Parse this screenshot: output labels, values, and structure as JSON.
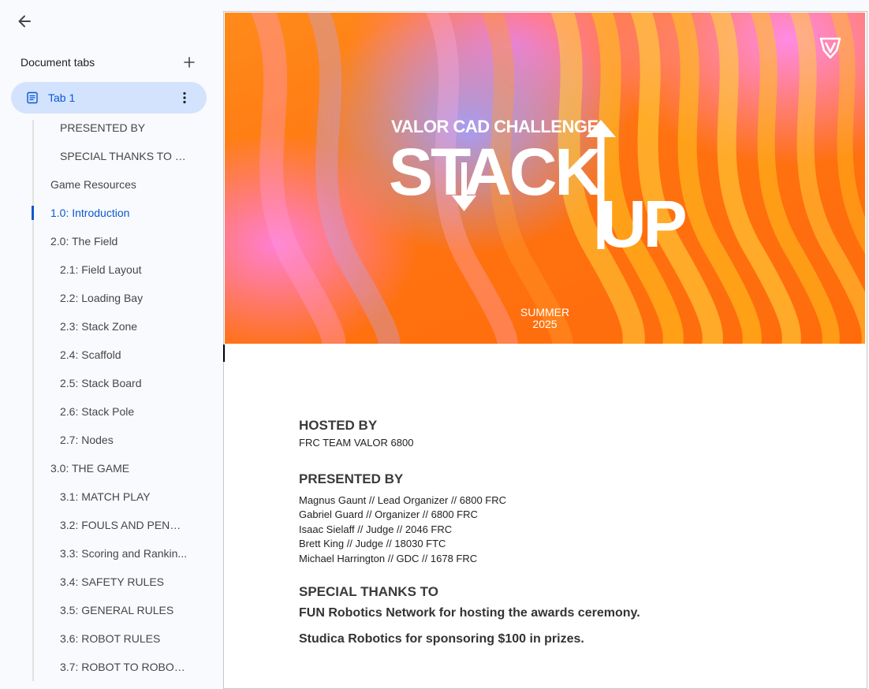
{
  "sidebar": {
    "tabs_title": "Document tabs",
    "active_tab": "Tab 1",
    "outline": [
      {
        "label": "PRESENTED BY",
        "level": 2
      },
      {
        "label": "SPECIAL THANKS TO F...",
        "level": 2
      },
      {
        "label": "Game Resources",
        "level": 1
      },
      {
        "label": "1.0: Introduction",
        "level": 1,
        "active": true
      },
      {
        "label": "2.0: The Field",
        "level": 1
      },
      {
        "label": "2.1: Field Layout",
        "level": 2
      },
      {
        "label": "2.2: Loading Bay",
        "level": 2
      },
      {
        "label": "2.3: Stack Zone",
        "level": 2
      },
      {
        "label": "2.4: Scaffold",
        "level": 2
      },
      {
        "label": "2.5: Stack Board",
        "level": 2
      },
      {
        "label": "2.6: Stack Pole",
        "level": 2
      },
      {
        "label": "2.7: Nodes",
        "level": 2
      },
      {
        "label": "3.0: THE GAME",
        "level": 1
      },
      {
        "label": "3.1: MATCH PLAY",
        "level": 2
      },
      {
        "label": "3.2: FOULS AND PENAL...",
        "level": 2
      },
      {
        "label": "3.3: Scoring and Rankin...",
        "level": 2
      },
      {
        "label": "3.4: SAFETY RULES",
        "level": 2
      },
      {
        "label": "3.5: GENERAL RULES",
        "level": 2
      },
      {
        "label": "3.6: ROBOT RULES",
        "level": 2
      },
      {
        "label": "3.7: ROBOT TO ROBOT ...",
        "level": 2
      }
    ]
  },
  "banner": {
    "challenge": "VALOR CAD CHALLENGE",
    "word1": "STACK",
    "word2": "UP",
    "season_line1": "SUMMER",
    "season_line2": "2025"
  },
  "document": {
    "hosted_heading": "HOSTED BY",
    "hosted_value": "FRC TEAM VALOR 6800",
    "presented_heading": "PRESENTED BY",
    "presenters": [
      "Magnus Gaunt // Lead Organizer // 6800 FRC",
      "Gabriel Guard // Organizer // 6800 FRC",
      "Isaac Sielaff // Judge // 2046 FRC",
      "Brett King // Judge //  18030 FTC",
      "Michael Harrington // GDC //  1678 FRC"
    ],
    "thanks_heading": "SPECIAL THANKS TO",
    "thanks": [
      "FUN Robotics Network for hosting the awards ceremony.",
      "Studica Robotics for sponsoring $100 in prizes."
    ]
  },
  "colors": {
    "accent": "#0b57d0",
    "pill_bg": "#d3e3fd",
    "sidebar_bg": "#f8fafd",
    "banner_orange": "#ff7410",
    "banner_pink": "#ff8ae4",
    "banner_lilac": "#a79cf2"
  },
  "icons": {
    "back": "arrow-left-icon",
    "add": "plus-icon",
    "doc": "document-icon",
    "more": "more-vert-icon"
  }
}
